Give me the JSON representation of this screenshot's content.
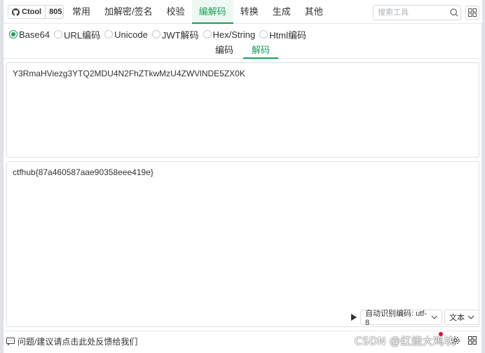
{
  "brand": {
    "name": "Ctool",
    "count": "805"
  },
  "nav": {
    "tabs": [
      {
        "label": "常用",
        "active": false
      },
      {
        "label": "加解密/签名",
        "active": false
      },
      {
        "label": "校验",
        "active": false
      },
      {
        "label": "编解码",
        "active": true
      },
      {
        "label": "转换",
        "active": false
      },
      {
        "label": "生成",
        "active": false
      },
      {
        "label": "其他",
        "active": false
      }
    ],
    "search_placeholder": "搜索工具"
  },
  "tools": [
    {
      "label": "Base64",
      "checked": true
    },
    {
      "label": "URL编码",
      "checked": false
    },
    {
      "label": "Unicode",
      "checked": false
    },
    {
      "label": "JWT解码",
      "checked": false
    },
    {
      "label": "Hex/String",
      "checked": false
    },
    {
      "label": "Html编码",
      "checked": false
    }
  ],
  "modes": {
    "encode": "编码",
    "decode": "解码",
    "active": "decode"
  },
  "input": {
    "value": "Y3RmaHViezg3YTQ2MDU4N2FhZTkwMzU4ZWVlNDE5ZX0K"
  },
  "output": {
    "value": "ctfhub{87a460587aae90358eee419e}"
  },
  "encoding_select": {
    "value": "自动识别编码: utf-8"
  },
  "type_select": {
    "value": "文本"
  },
  "footer": {
    "feedback": "问题/建议请点击此处反馈给我们"
  },
  "watermark": "CSDN @红烧大鸡块",
  "colors": {
    "accent": "#18a058",
    "border": "#dcdfe4"
  }
}
